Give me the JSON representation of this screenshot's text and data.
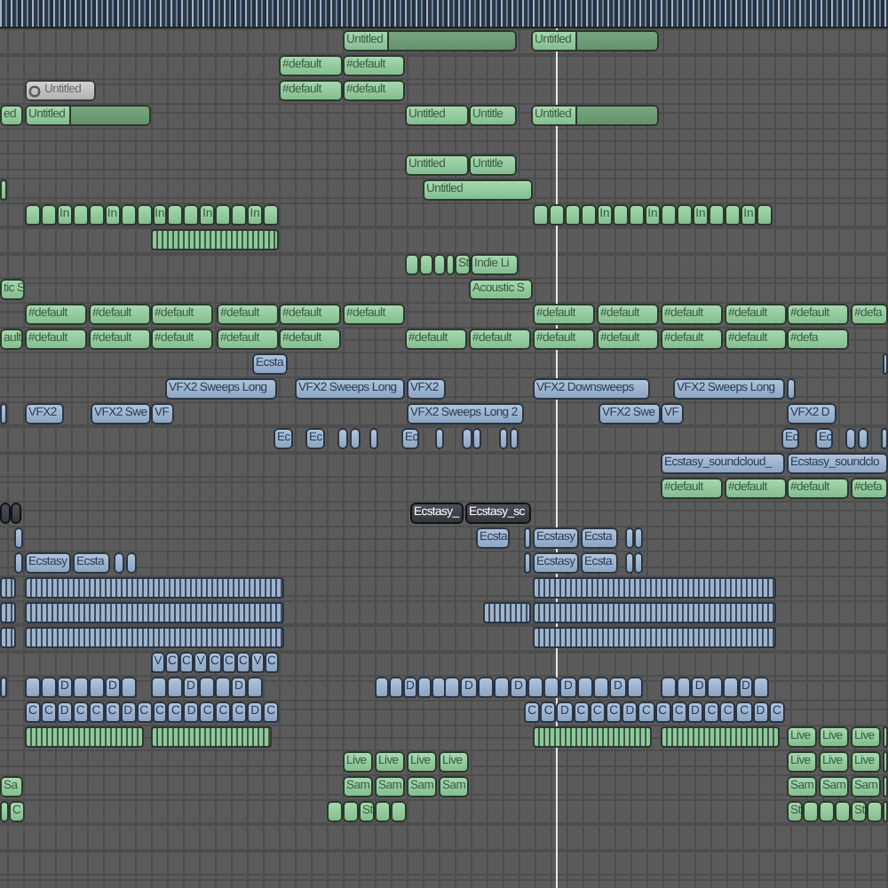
{
  "lanes": [
    {
      "regions": [
        {
          "kind": "midi-loop",
          "label": "Untitled",
          "selected": false
        },
        {
          "kind": "midi-loop",
          "label": "Untitled",
          "selected": false
        }
      ]
    },
    {
      "regions": [
        {
          "kind": "midi",
          "label": "#default",
          "selected": false
        },
        {
          "kind": "midi",
          "label": "#default",
          "selected": false
        }
      ]
    },
    {
      "regions": [
        {
          "kind": "midi-muted",
          "label": "Untitled",
          "selected": false
        },
        {
          "kind": "midi",
          "label": "#default",
          "selected": false
        },
        {
          "kind": "midi",
          "label": "#default",
          "selected": false
        }
      ]
    },
    {
      "regions": [
        {
          "kind": "midi",
          "label": "ed",
          "selected": false
        },
        {
          "kind": "midi-loop",
          "label": "Untitled",
          "selected": false
        },
        {
          "kind": "midi",
          "label": "Untitled",
          "selected": false
        },
        {
          "kind": "midi",
          "label": "Untitle",
          "selected": false
        },
        {
          "kind": "midi-loop",
          "label": "Untitled",
          "selected": false
        }
      ]
    },
    {
      "regions": [
        {
          "kind": "midi",
          "label": "Untitled",
          "selected": false
        },
        {
          "kind": "midi",
          "label": "Untitle",
          "selected": false
        }
      ]
    },
    {
      "regions": [
        {
          "kind": "midi",
          "selected": false
        },
        {
          "kind": "midi",
          "label": "Untitled",
          "selected": false
        }
      ]
    },
    {
      "regions": [
        {
          "kind": "midi-strip",
          "clips": [
            {
              "selected": false
            },
            {
              "selected": false
            },
            {
              "label": "In",
              "selected": false
            },
            {
              "selected": false
            },
            {
              "selected": false
            },
            {
              "label": "In",
              "selected": false
            },
            {
              "selected": false
            },
            {
              "selected": false
            },
            {
              "label": "In",
              "selected": false
            },
            {
              "selected": false
            },
            {
              "selected": false
            },
            {
              "label": "In",
              "selected": false
            },
            {
              "selected": false
            },
            {
              "selected": false
            },
            {
              "label": "In",
              "selected": false
            },
            {
              "selected": false
            }
          ]
        },
        {
          "kind": "midi-strip",
          "clips": [
            {
              "selected": false
            },
            {
              "selected": false
            },
            {
              "selected": false
            },
            {
              "selected": false
            },
            {
              "label": "In",
              "selected": false
            },
            {
              "selected": false
            },
            {
              "selected": false
            },
            {
              "label": "In",
              "selected": false
            },
            {
              "selected": false
            },
            {
              "selected": false
            },
            {
              "label": "In",
              "selected": false
            },
            {
              "selected": false
            },
            {
              "selected": false
            },
            {
              "label": "In",
              "selected": false
            },
            {
              "selected": false
            }
          ]
        }
      ]
    },
    {
      "regions": [
        {
          "kind": "midi-dense"
        }
      ]
    },
    {
      "regions": [
        {
          "kind": "midi",
          "selected": false
        },
        {
          "kind": "midi",
          "selected": false
        },
        {
          "kind": "midi",
          "selected": false
        },
        {
          "kind": "midi",
          "selected": false
        },
        {
          "kind": "midi",
          "label": "St",
          "selected": false
        },
        {
          "kind": "midi",
          "label": "Indie Li",
          "selected": false
        }
      ]
    },
    {
      "regions": [
        {
          "kind": "midi",
          "label": "tic S",
          "selected": false
        },
        {
          "kind": "midi",
          "label": "Acoustic S",
          "selected": false
        }
      ]
    },
    {
      "regions": [
        {
          "kind": "midi",
          "label": "#default",
          "selected": false
        },
        {
          "kind": "midi",
          "label": "#default",
          "selected": false
        },
        {
          "kind": "midi",
          "label": "#default",
          "selected": false
        },
        {
          "kind": "midi",
          "label": "#default",
          "selected": false
        },
        {
          "kind": "midi",
          "label": "#default",
          "selected": false
        },
        {
          "kind": "midi",
          "label": "#default",
          "selected": false
        },
        {
          "kind": "midi",
          "label": "#default",
          "selected": false
        },
        {
          "kind": "midi",
          "label": "#default",
          "selected": false
        },
        {
          "kind": "midi",
          "label": "#default",
          "selected": false
        },
        {
          "kind": "midi",
          "label": "#default",
          "selected": false
        },
        {
          "kind": "midi",
          "label": "#default",
          "selected": false
        },
        {
          "kind": "midi",
          "label": "#defa",
          "selected": false
        }
      ]
    },
    {
      "regions": [
        {
          "kind": "midi",
          "label": "ault",
          "selected": false
        },
        {
          "kind": "midi",
          "label": "#default",
          "selected": false
        },
        {
          "kind": "midi",
          "label": "#default",
          "selected": false
        },
        {
          "kind": "midi",
          "label": "#default",
          "selected": false
        },
        {
          "kind": "midi",
          "label": "#default",
          "selected": false
        },
        {
          "kind": "midi",
          "label": "#default",
          "selected": false
        },
        {
          "kind": "midi",
          "label": "#default",
          "selected": false
        },
        {
          "kind": "midi",
          "label": "#default",
          "selected": false
        },
        {
          "kind": "midi",
          "label": "#default",
          "selected": false
        },
        {
          "kind": "midi",
          "label": "#default",
          "selected": false
        },
        {
          "kind": "midi",
          "label": "#default",
          "selected": false
        },
        {
          "kind": "midi",
          "label": "#default",
          "selected": false
        },
        {
          "kind": "midi",
          "label": "#defa",
          "selected": false
        }
      ]
    },
    {
      "regions": [
        {
          "kind": "audio",
          "label": "Ecsta",
          "selected": false
        },
        {
          "kind": "audio",
          "selected": false
        }
      ]
    },
    {
      "regions": [
        {
          "kind": "audio",
          "label": "VFX2 Sweeps Long",
          "selected": false
        },
        {
          "kind": "audio",
          "label": "VFX2 Sweeps Long",
          "selected": false
        },
        {
          "kind": "audio",
          "label": "VFX2",
          "selected": false
        },
        {
          "kind": "audio",
          "label": "VFX2 Downsweeps",
          "selected": false
        },
        {
          "kind": "audio",
          "label": "VFX2 Sweeps Long",
          "selected": false
        },
        {
          "kind": "audio",
          "selected": false
        }
      ]
    },
    {
      "regions": [
        {
          "kind": "audio",
          "selected": false
        },
        {
          "kind": "audio",
          "label": "VFX2",
          "selected": false
        },
        {
          "kind": "audio",
          "label": "VFX2 Swe",
          "selected": false
        },
        {
          "kind": "audio",
          "label": "VF",
          "selected": false
        },
        {
          "kind": "audio",
          "label": "VFX2 Sweeps Long 2",
          "selected": false
        },
        {
          "kind": "audio",
          "label": "VFX2 Swe",
          "selected": false
        },
        {
          "kind": "audio",
          "label": "VF",
          "selected": false
        },
        {
          "kind": "audio",
          "label": "VFX2 D",
          "selected": false
        }
      ]
    },
    {
      "regions": [
        {
          "kind": "audio",
          "label": "Ec",
          "selected": false
        },
        {
          "kind": "audio",
          "label": "Ec",
          "selected": false
        },
        {
          "kind": "audio",
          "selected": false
        },
        {
          "kind": "audio",
          "selected": false
        },
        {
          "kind": "audio",
          "selected": false
        },
        {
          "kind": "audio",
          "label": "Ec",
          "selected": false
        },
        {
          "kind": "audio",
          "selected": false
        },
        {
          "kind": "audio",
          "selected": false
        },
        {
          "kind": "audio",
          "selected": false
        },
        {
          "kind": "audio",
          "selected": false
        },
        {
          "kind": "audio",
          "selected": false
        },
        {
          "kind": "audio",
          "label": "Ec",
          "selected": false
        },
        {
          "kind": "audio",
          "label": "Ec",
          "selected": false
        },
        {
          "kind": "audio",
          "selected": false
        },
        {
          "kind": "audio",
          "selected": false
        },
        {
          "kind": "audio",
          "selected": false
        }
      ]
    },
    {
      "regions": [
        {
          "kind": "audio",
          "label": "Ecstasy_soundcloud_",
          "selected": false
        },
        {
          "kind": "audio",
          "label": "Ecstasy_soundclo",
          "selected": false
        }
      ]
    },
    {
      "regions": [
        {
          "kind": "midi",
          "label": "#default",
          "selected": false
        },
        {
          "kind": "midi",
          "label": "#default",
          "selected": false
        },
        {
          "kind": "midi",
          "label": "#default",
          "selected": false
        },
        {
          "kind": "midi",
          "label": "#defa",
          "selected": false
        }
      ]
    },
    {
      "regions": [
        {
          "kind": "audio",
          "selected": true
        },
        {
          "kind": "audio",
          "selected": true
        },
        {
          "kind": "audio",
          "label": "Ecstasy_",
          "selected": true
        },
        {
          "kind": "audio",
          "label": "Ecstasy_sc",
          "selected": true
        }
      ]
    },
    {
      "regions": [
        {
          "kind": "audio",
          "selected": false
        },
        {
          "kind": "audio",
          "label": "Ecsta",
          "selected": false
        },
        {
          "kind": "audio",
          "selected": false
        },
        {
          "kind": "audio",
          "label": "Ecstasy",
          "selected": false
        },
        {
          "kind": "audio",
          "label": "Ecsta",
          "selected": false
        },
        {
          "kind": "audio",
          "selected": false
        },
        {
          "kind": "audio",
          "selected": false
        }
      ]
    },
    {
      "regions": [
        {
          "kind": "audio",
          "selected": false
        },
        {
          "kind": "audio",
          "label": "Ecstasy",
          "selected": false
        },
        {
          "kind": "audio",
          "label": "Ecsta",
          "selected": false
        },
        {
          "kind": "audio",
          "selected": false
        },
        {
          "kind": "audio",
          "selected": false
        },
        {
          "kind": "audio",
          "selected": false
        },
        {
          "kind": "audio",
          "label": "Ecstasy",
          "selected": false
        },
        {
          "kind": "audio",
          "label": "Ecsta",
          "selected": false
        },
        {
          "kind": "audio",
          "selected": false
        },
        {
          "kind": "audio",
          "selected": false
        }
      ]
    },
    {
      "regions": [
        {
          "kind": "audio-dense"
        },
        {
          "kind": "audio-dense"
        },
        {
          "kind": "audio-dense"
        }
      ]
    },
    {
      "regions": [
        {
          "kind": "audio-dense"
        },
        {
          "kind": "audio-dense"
        },
        {
          "kind": "audio-dense"
        },
        {
          "kind": "audio-dense"
        }
      ]
    },
    {
      "regions": [
        {
          "kind": "audio-dense"
        },
        {
          "kind": "audio-dense"
        },
        {
          "kind": "audio-dense"
        }
      ]
    },
    {
      "regions": [
        {
          "kind": "audio-strip",
          "clips": [
            {
              "label": "V",
              "selected": false
            },
            {
              "label": "C",
              "selected": false
            },
            {
              "label": "C",
              "selected": false
            },
            {
              "label": "V",
              "selected": false
            },
            {
              "label": "C",
              "selected": false
            },
            {
              "label": "C",
              "selected": false
            },
            {
              "label": "C",
              "selected": false
            },
            {
              "label": "V",
              "selected": false
            },
            {
              "label": "C",
              "selected": false
            }
          ]
        }
      ]
    },
    {
      "regions": [
        {
          "kind": "audio",
          "selected": false
        },
        {
          "kind": "audio-strip",
          "clips": [
            {
              "selected": false
            },
            {
              "selected": false
            },
            {
              "label": "D",
              "selected": false
            },
            {
              "selected": false
            },
            {
              "selected": false
            },
            {
              "label": "D",
              "selected": false
            },
            {
              "selected": false
            }
          ]
        },
        {
          "kind": "audio-strip",
          "clips": [
            {
              "selected": false
            },
            {
              "selected": false
            },
            {
              "label": "D",
              "selected": false
            },
            {
              "selected": false
            },
            {
              "selected": false
            },
            {
              "label": "D",
              "selected": false
            },
            {
              "selected": false
            }
          ]
        },
        {
          "kind": "audio-strip",
          "clips": [
            {
              "selected": false
            },
            {
              "selected": false
            },
            {
              "label": "D",
              "selected": false
            },
            {
              "selected": false
            },
            {
              "selected": false
            }
          ]
        },
        {
          "kind": "audio-strip",
          "clips": [
            {
              "selected": false
            },
            {
              "label": "D",
              "selected": false
            },
            {
              "selected": false
            },
            {
              "selected": false
            },
            {
              "label": "D",
              "selected": false
            },
            {
              "selected": false
            },
            {
              "selected": false
            },
            {
              "label": "D",
              "selected": false
            },
            {
              "selected": false
            },
            {
              "selected": false
            },
            {
              "label": "D",
              "selected": false
            },
            {
              "selected": false
            }
          ]
        },
        {
          "kind": "audio-strip",
          "clips": [
            {
              "selected": false
            },
            {
              "selected": false
            },
            {
              "label": "D",
              "selected": false
            },
            {
              "selected": false
            },
            {
              "selected": false
            },
            {
              "label": "D",
              "selected": false
            },
            {
              "selected": false
            }
          ]
        }
      ]
    },
    {
      "regions": [
        {
          "kind": "audio-strip",
          "clips": [
            {
              "label": "C",
              "selected": false
            },
            {
              "label": "C",
              "selected": false
            },
            {
              "label": "D",
              "selected": false
            },
            {
              "label": "C",
              "selected": false
            },
            {
              "label": "C",
              "selected": false
            },
            {
              "label": "C",
              "selected": false
            },
            {
              "label": "D",
              "selected": false
            },
            {
              "label": "C",
              "selected": false
            },
            {
              "label": "C",
              "selected": false
            },
            {
              "label": "C",
              "selected": false
            },
            {
              "label": "D",
              "selected": false
            },
            {
              "label": "C",
              "selected": false
            },
            {
              "label": "C",
              "selected": false
            },
            {
              "label": "C",
              "selected": false
            },
            {
              "label": "D",
              "selected": false
            },
            {
              "label": "C",
              "selected": false
            }
          ]
        },
        {
          "kind": "audio-strip",
          "clips": [
            {
              "label": "C",
              "selected": false
            },
            {
              "label": "C",
              "selected": false
            },
            {
              "label": "D",
              "selected": false
            },
            {
              "label": "C",
              "selected": false
            },
            {
              "label": "C",
              "selected": false
            },
            {
              "label": "C",
              "selected": false
            },
            {
              "label": "D",
              "selected": false
            },
            {
              "label": "C",
              "selected": false
            },
            {
              "label": "C",
              "selected": false
            },
            {
              "label": "C",
              "selected": false
            },
            {
              "label": "D",
              "selected": false
            },
            {
              "label": "C",
              "selected": false
            },
            {
              "label": "C",
              "selected": false
            },
            {
              "label": "C",
              "selected": false
            },
            {
              "label": "D",
              "selected": false
            },
            {
              "label": "C",
              "selected": false
            }
          ]
        }
      ]
    },
    {
      "regions": [
        {
          "kind": "midi-dense"
        },
        {
          "kind": "midi-dense"
        },
        {
          "kind": "midi-dense"
        },
        {
          "kind": "midi-dense"
        },
        {
          "kind": "midi",
          "label": "Live",
          "selected": false
        },
        {
          "kind": "midi",
          "label": "Live",
          "selected": false
        },
        {
          "kind": "midi",
          "label": "Live",
          "selected": false
        },
        {
          "kind": "midi",
          "selected": false
        }
      ]
    },
    {
      "regions": [
        {
          "kind": "midi",
          "label": "Live",
          "selected": false
        },
        {
          "kind": "midi",
          "label": "Live",
          "selected": false
        },
        {
          "kind": "midi",
          "label": "Live",
          "selected": false
        },
        {
          "kind": "midi",
          "label": "Live",
          "selected": false
        },
        {
          "kind": "midi",
          "label": "Live",
          "selected": false
        },
        {
          "kind": "midi",
          "label": "Live",
          "selected": false
        },
        {
          "kind": "midi",
          "label": "Live",
          "selected": false
        },
        {
          "kind": "midi",
          "selected": false
        }
      ]
    },
    {
      "regions": [
        {
          "kind": "midi",
          "label": "Sa",
          "selected": false
        },
        {
          "kind": "midi",
          "label": "Sam",
          "selected": false
        },
        {
          "kind": "midi",
          "label": "Sam",
          "selected": false
        },
        {
          "kind": "midi",
          "label": "Sam",
          "selected": false
        },
        {
          "kind": "midi",
          "label": "Sam",
          "selected": false
        },
        {
          "kind": "midi",
          "label": "Sam",
          "selected": false
        },
        {
          "kind": "midi",
          "label": "Sam",
          "selected": false
        },
        {
          "kind": "midi",
          "label": "Sam",
          "selected": false
        },
        {
          "kind": "midi",
          "selected": false
        }
      ]
    },
    {
      "regions": [
        {
          "kind": "midi",
          "selected": false
        },
        {
          "kind": "midi",
          "label": "C",
          "selected": false
        },
        {
          "kind": "midi",
          "selected": false
        },
        {
          "kind": "midi",
          "selected": false
        },
        {
          "kind": "midi",
          "label": "St",
          "selected": false
        },
        {
          "kind": "midi",
          "selected": false
        },
        {
          "kind": "midi",
          "selected": false
        },
        {
          "kind": "midi",
          "label": "St",
          "selected": false
        },
        {
          "kind": "midi",
          "selected": false
        },
        {
          "kind": "midi",
          "selected": false
        },
        {
          "kind": "midi",
          "selected": false
        },
        {
          "kind": "midi",
          "label": "St",
          "selected": false
        },
        {
          "kind": "midi",
          "selected": false
        },
        {
          "kind": "midi",
          "selected": false
        }
      ]
    }
  ]
}
